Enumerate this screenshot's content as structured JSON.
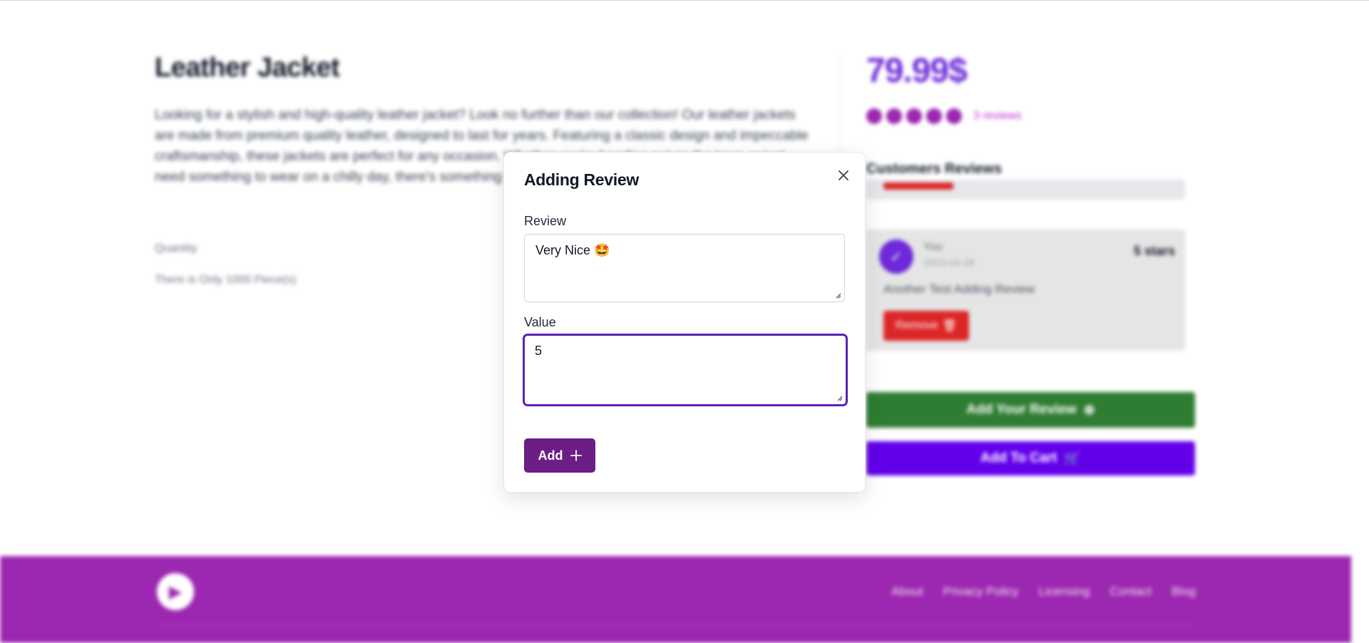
{
  "product": {
    "title": "Leather Jacket",
    "description": "Looking for a stylish and high-quality leather jacket? Look no further than our collection! Our leather jackets are made from premium quality leather, designed to last for years. Featuring a classic design and impeccable craftsmanship, these jackets are perfect for any occasion. Whether you're heading out on the town or just need something to wear on a chilly day, there's something for everyone. Shop now and elevate your style.",
    "quantity_label": "Quantity",
    "stock_text": "There is Only 1000 Piece(s)",
    "price": "79.99$",
    "rating": 5,
    "rating_max": 5,
    "reviews_count_text": "3 reviews"
  },
  "customer_reviews": {
    "title": "Customers Reviews",
    "bar_fraction": 0.22,
    "card": {
      "avatar_icon": "user-check-icon",
      "user": "You",
      "date": "2023-04-28",
      "stars_text": "5 stars",
      "text": "Another Test Adding Review",
      "remove_label": "Remove"
    }
  },
  "actions": {
    "add_review_label": "Add Your Review",
    "add_to_cart_label": "Add To Cart"
  },
  "footer": {
    "logo_icon": "play-logo-icon",
    "links": [
      "About",
      "Privacy Policy",
      "Licensing",
      "Contact",
      "Blog"
    ]
  },
  "modal": {
    "title": "Adding Review",
    "close_icon": "close-icon",
    "review_label": "Review",
    "review_value": "Very Nice 🤩",
    "value_label": "Value",
    "value_value": "5",
    "add_label": "Add",
    "add_icon": "plus-icon"
  },
  "colors": {
    "accent_purple": "#9c27b0",
    "price_purple": "#6d28d9",
    "add_button": "#6b1e84",
    "focus_border": "#5b21b6",
    "review_green": "#2e7d32",
    "cart_purple": "#6200ea",
    "remove_red": "#dc2626"
  }
}
